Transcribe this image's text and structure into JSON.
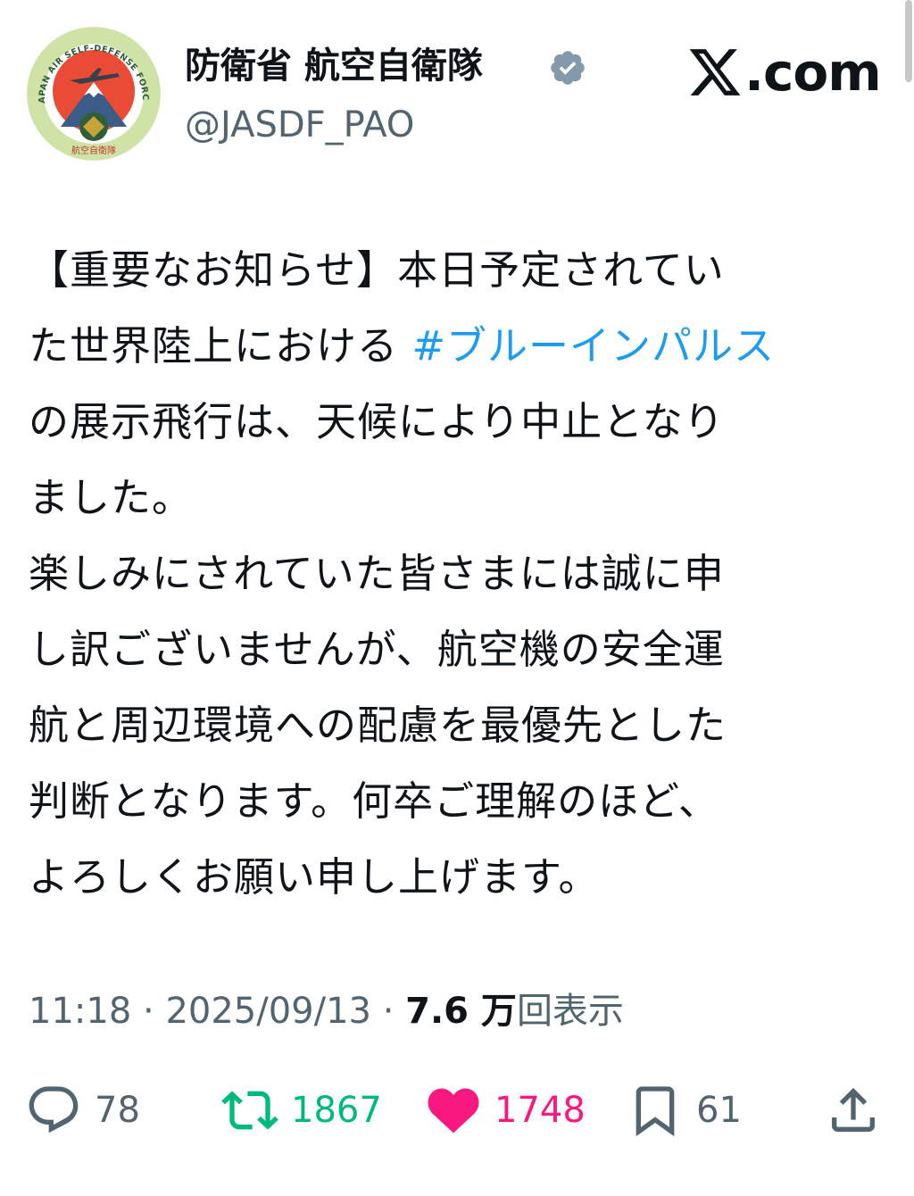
{
  "header": {
    "display_name": "防衛省 航空自衛隊",
    "handle": "@JASDF_PAO",
    "site": "com",
    "site_logo_glyph": "X",
    "avatar": {
      "ring_text": "JAPAN AIR SELF-DEFENSE FORCE",
      "bottom_text": "航空自衛隊",
      "colors": {
        "ring": "#cfe3a6",
        "sun": "#e94b35",
        "mountain": "#3b5c86"
      }
    },
    "verified_icon": "verified-badge-icon"
  },
  "tweet": {
    "lines": [
      {
        "text": "【重要なお知らせ】本日予定されてい"
      },
      {
        "text": "た世界陸上における ",
        "hashtag": "#ブルーインパルス"
      },
      {
        "text": "の展示飛行は、天候により中止となり"
      },
      {
        "text": "ました。"
      },
      {
        "text": "楽しみにされていた皆さまには誠に申"
      },
      {
        "text": "し訳ございませんが、航空機の安全運"
      },
      {
        "text": "航と周辺環境への配慮を最優先とした"
      },
      {
        "text": "判断となります。何卒ご理解のほど、"
      },
      {
        "text": "よろしくお願い申し上げます。"
      }
    ]
  },
  "meta": {
    "time": "11:18",
    "separator": " · ",
    "date": "2025/09/13",
    "views_count": "7.6 万",
    "views_label": "回表示"
  },
  "actions": {
    "reply": {
      "icon": "reply-icon",
      "count": "78"
    },
    "retweet": {
      "icon": "retweet-icon",
      "count": "1867",
      "color": "#00ba7c"
    },
    "like": {
      "icon": "heart-icon",
      "count": "1748",
      "color": "#f91880"
    },
    "bookmark": {
      "icon": "bookmark-icon",
      "count": "61"
    },
    "share": {
      "icon": "share-icon"
    }
  }
}
